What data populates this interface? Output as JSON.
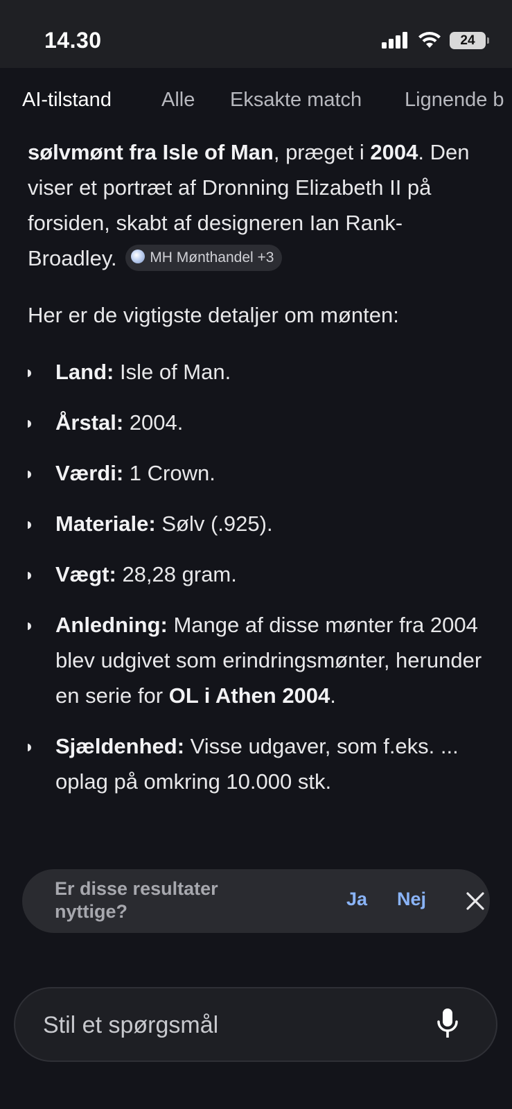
{
  "status_bar": {
    "time": "14.30",
    "battery": "24"
  },
  "tabs": [
    {
      "label": "AI-tilstand",
      "active": true
    },
    {
      "label": "Alle"
    },
    {
      "label": "Eksakte match"
    },
    {
      "label": "Lignende b"
    }
  ],
  "answer": {
    "intro": {
      "bold1": "sølvmønt fra Isle of Man",
      "text1": ", præget i ",
      "bold2": "2004",
      "text2": ". Den viser et portræt af Dronning Elizabeth II på forsiden, skabt af designeren Ian Rank-Broadley.",
      "source_chip": "MH Mønthandel +3"
    },
    "details_heading": "Her er de vigtigste detaljer om mønten:",
    "facts": [
      {
        "label": "Land:",
        "value": " Isle of Man."
      },
      {
        "label": "Årstal:",
        "value": " 2004."
      },
      {
        "label": "Værdi:",
        "value": " 1 Crown."
      },
      {
        "label": "Materiale:",
        "value": " Sølv (.925)."
      },
      {
        "label": "Vægt:",
        "value": " 28,28 gram."
      },
      {
        "label": "Anledning:",
        "value": " Mange af disse mønter fra 2004 blev udgivet som erindringsmønter, herunder en serie for ",
        "bold_tail": "OL i Athen 2004",
        "tail": "."
      },
      {
        "label": "Sjældenhed:",
        "value": " Visse udgaver, som f.eks. ... oplag på omkring 10.000 stk."
      }
    ]
  },
  "feedback": {
    "question": "Er disse resultater nyttige?",
    "yes": "Ja",
    "no": "Nej"
  },
  "ask_bar": {
    "placeholder": "Stil et spørgsmål"
  },
  "colors": {
    "background": "#13141a",
    "accent": "#8ab4f8"
  }
}
